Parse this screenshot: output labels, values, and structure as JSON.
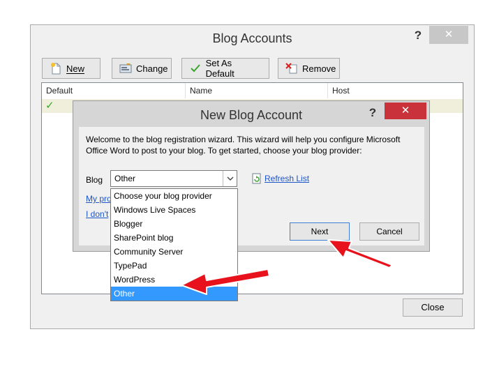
{
  "outer_dialog": {
    "title": "Blog Accounts",
    "help": "?",
    "close": "✕",
    "toolbar": {
      "new_label": "New",
      "change_label": "Change",
      "set_default_label": "Set As Default",
      "remove_label": "Remove"
    },
    "columns": [
      "Default",
      "Name",
      "Host"
    ],
    "close_button": "Close"
  },
  "inner_dialog": {
    "title": "New Blog Account",
    "help": "?",
    "close": "✕",
    "intro": "Welcome to the blog registration wizard. This wizard will help you configure Microsoft Office Word to post to your blog. To get started, choose your blog provider:",
    "blog_label": "Blog",
    "selected": "Other",
    "refresh_label": "Refresh List",
    "link_my_provider": "My pro",
    "link_i_dont": "I don't",
    "next_label": "Next",
    "cancel_label": "Cancel"
  },
  "dropdown": {
    "options": [
      "Choose your blog provider",
      "Windows Live Spaces",
      "Blogger",
      "SharePoint blog",
      "Community Server",
      "TypePad",
      "WordPress",
      "Other"
    ]
  },
  "colors": {
    "selection": "#3399ff",
    "close_red": "#c9323a",
    "annotation_arrow": "#e8121c",
    "link": "#1c55c8"
  }
}
